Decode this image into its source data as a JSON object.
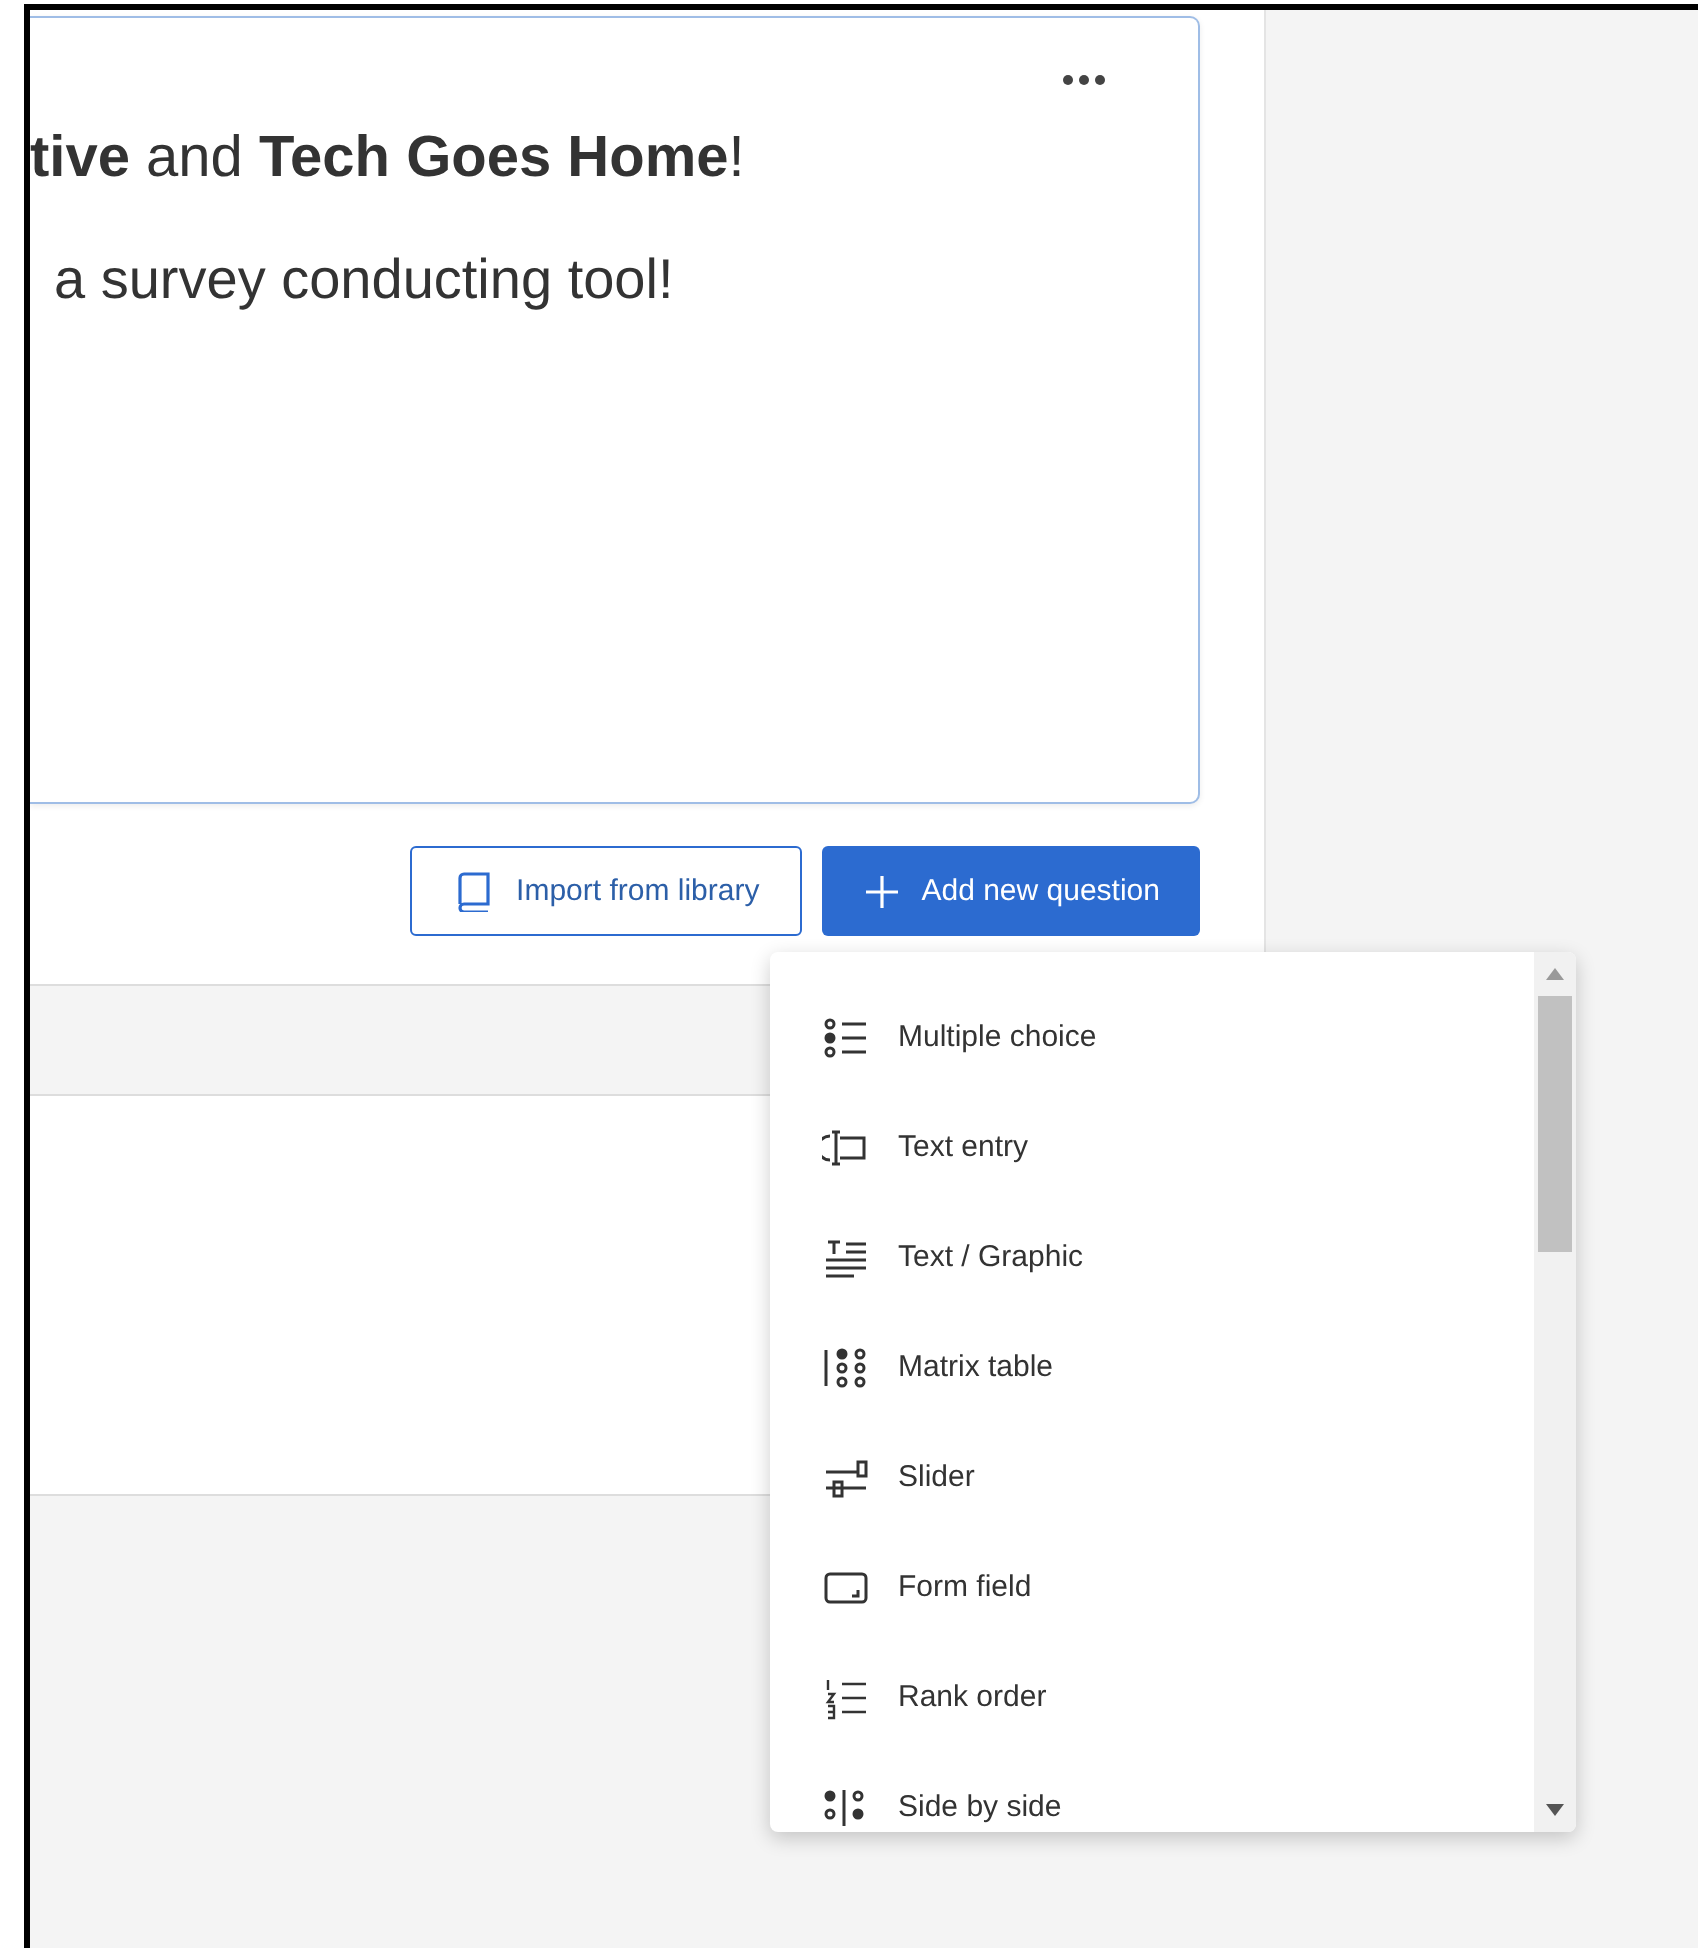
{
  "question_card": {
    "heading": "**tive** and **Tech Goes Home**!",
    "subtext": "a survey conducting tool!"
  },
  "actions": [
    {
      "kind": "secondary",
      "label": "Import from library"
    },
    {
      "kind": "primary",
      "label": "Add new question"
    }
  ],
  "question_types": [
    {
      "kind": "multiple",
      "label": "Multiple choice"
    },
    {
      "kind": "textentry",
      "label": "Text entry"
    },
    {
      "kind": "graphic",
      "label": "Text / Graphic"
    },
    {
      "kind": "matrix",
      "label": "Matrix table"
    },
    {
      "kind": "slider",
      "label": "Slider"
    },
    {
      "kind": "form",
      "label": "Form field"
    },
    {
      "kind": "rank",
      "label": "Rank order"
    },
    {
      "kind": "side",
      "label": "Side by side"
    }
  ]
}
